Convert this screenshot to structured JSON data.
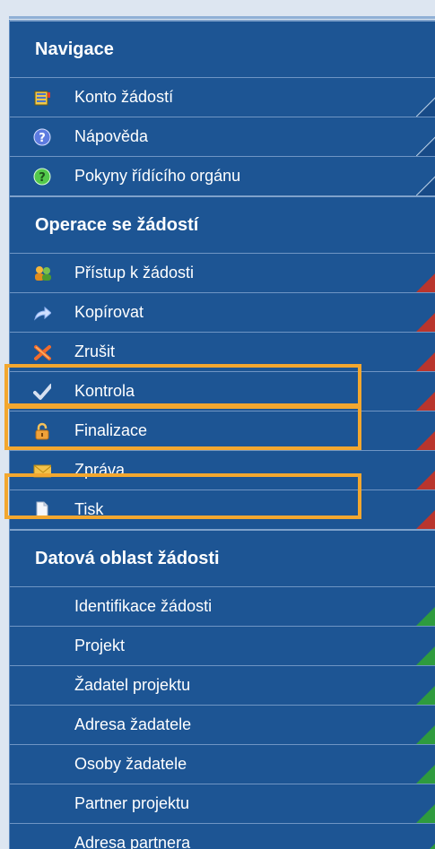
{
  "navigation": {
    "title": "Navigace",
    "items": [
      {
        "label": "Konto žádostí",
        "icon": "notebook-icon"
      },
      {
        "label": "Nápověda",
        "icon": "help-icon"
      },
      {
        "label": "Pokyny řídícího orgánu",
        "icon": "help-green-icon"
      }
    ]
  },
  "operations": {
    "title": "Operace se žádostí",
    "items": [
      {
        "label": "Přístup k žádosti",
        "icon": "users-icon"
      },
      {
        "label": "Kopírovat",
        "icon": "arrow-right-icon"
      },
      {
        "label": "Zrušit",
        "icon": "cancel-icon"
      },
      {
        "label": "Kontrola",
        "icon": "check-icon"
      },
      {
        "label": "Finalizace",
        "icon": "lock-icon"
      },
      {
        "label": "Zpráva",
        "icon": "envelope-icon"
      },
      {
        "label": "Tisk",
        "icon": "page-icon"
      }
    ]
  },
  "data_area": {
    "title": "Datová oblast žádosti",
    "items": [
      {
        "label": "Identifikace žádosti"
      },
      {
        "label": "Projekt"
      },
      {
        "label": "Žadatel projektu"
      },
      {
        "label": "Adresa žadatele"
      },
      {
        "label": "Osoby žadatele"
      },
      {
        "label": "Partner projektu"
      },
      {
        "label": "Adresa partnera"
      }
    ]
  },
  "colors": {
    "panel": "#1d5594",
    "highlight": "#f2a72f",
    "corner_red": "#b9352d",
    "corner_green": "#2e9b3e"
  }
}
